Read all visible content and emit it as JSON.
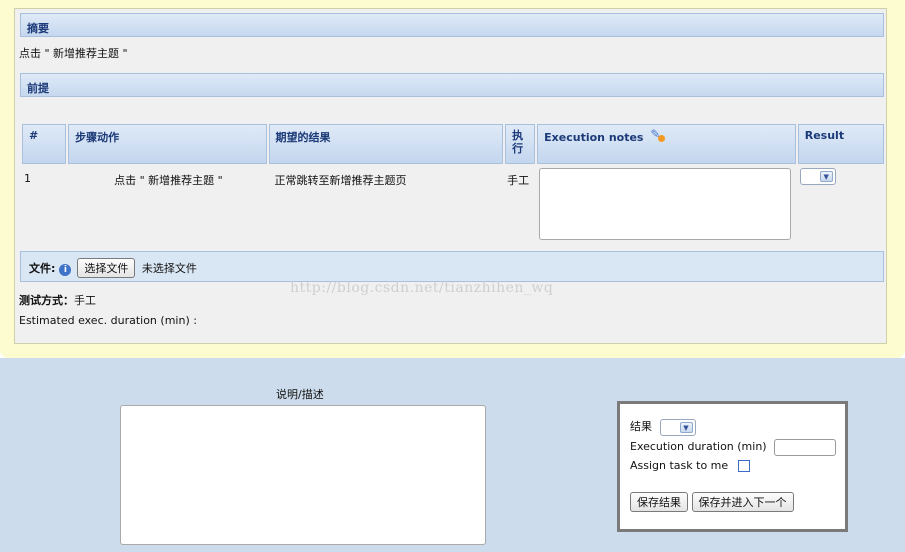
{
  "sections": {
    "summary_title": "摘要",
    "summary_text": "点击 \" 新增推荐主题 \"",
    "preconditions_title": "前提"
  },
  "steps_table": {
    "headers": {
      "num": "#",
      "action": "步骤动作",
      "expected": "期望的结果",
      "exec": "执\n行",
      "notes": "Execution notes",
      "result": "Result"
    },
    "rows": [
      {
        "num": "1",
        "action": "点击 \" 新增推荐主题 \"",
        "expected": "正常跳转至新增推荐主题页",
        "exec": "手工",
        "result_value": ""
      }
    ]
  },
  "attachment": {
    "label": "文件:",
    "choose_button": "选择文件",
    "no_file_text": "未选择文件"
  },
  "test_mode": {
    "label": "测试方式：",
    "value": "手工"
  },
  "estimated_duration": {
    "label": "Estimated exec. duration (min) :",
    "value": ""
  },
  "watermark": "http://blog.csdn.net/tianzhihen_wq",
  "description": {
    "label": "说明/描述",
    "value": ""
  },
  "result_panel": {
    "result_label": "结果",
    "result_value": "",
    "duration_label": "Execution duration (min)",
    "duration_value": "",
    "assign_label": "Assign task to me",
    "assign_checked": false,
    "save_button": "保存结果",
    "save_next_button": "保存并进入下一个"
  },
  "icons": {
    "notes_edit": "edit-pen-icon",
    "info": "info-icon",
    "dropdown": "chevron-down-icon"
  }
}
